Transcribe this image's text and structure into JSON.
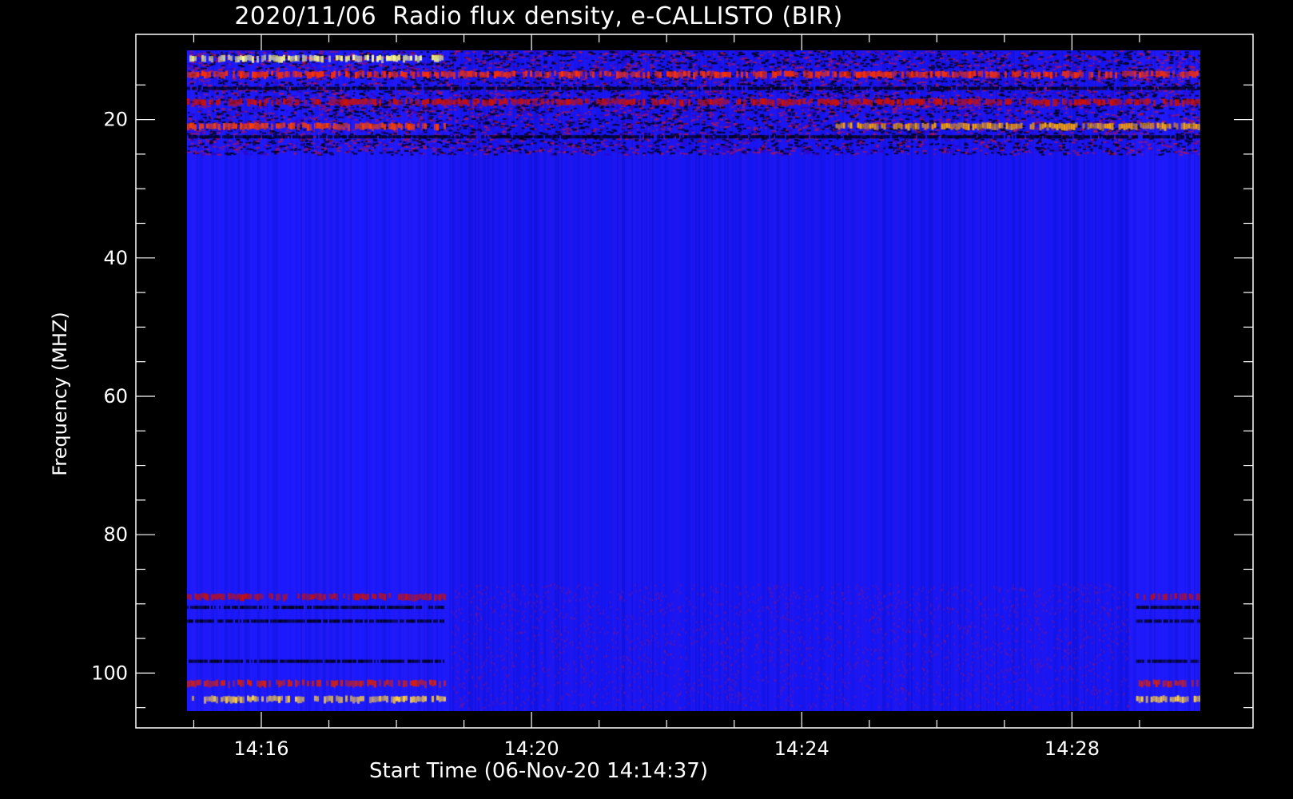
{
  "chart_data": {
    "type": "heatmap",
    "title": "2020/11/06  Radio flux density, e-CALLISTO (BIR)",
    "xlabel": "Start Time (06-Nov-20 14:14:37)",
    "ylabel": "Frequency (MHZ)",
    "x_range_minutes": [
      14.9,
      29.9
    ],
    "y_range_mhz": [
      10,
      105.5
    ],
    "y_inverted": true,
    "x_ticks": [
      {
        "minute": 16,
        "label": "14:16"
      },
      {
        "minute": 20,
        "label": "14:20"
      },
      {
        "minute": 24,
        "label": "14:24"
      },
      {
        "minute": 28,
        "label": "14:28"
      }
    ],
    "y_ticks": [
      {
        "value": 20,
        "label": "20"
      },
      {
        "value": 40,
        "label": "40"
      },
      {
        "value": 60,
        "label": "60"
      },
      {
        "value": 80,
        "label": "80"
      },
      {
        "value": 100,
        "label": "100"
      }
    ],
    "colormap": [
      "#000000",
      "#0000ff",
      "#ff0000",
      "#ffff00",
      "#ffffff"
    ],
    "segments": [
      {
        "start_minute": 14.9,
        "end_minute": 18.8
      },
      {
        "start_minute": 18.8,
        "end_minute": 28.85
      },
      {
        "start_minute": 28.85,
        "end_minute": 29.9
      }
    ],
    "bright_bands": [
      {
        "freq_mhz": 11.2,
        "start_minute": 14.9,
        "end_minute": 18.7,
        "color": "#ffff88"
      },
      {
        "freq_mhz": 13.5,
        "start_minute": 14.9,
        "end_minute": 29.9,
        "color": "#ff3000"
      },
      {
        "freq_mhz": 17.5,
        "start_minute": 14.9,
        "end_minute": 29.9,
        "color": "#d01000"
      },
      {
        "freq_mhz": 21.0,
        "start_minute": 14.9,
        "end_minute": 18.7,
        "color": "#ff4000"
      },
      {
        "freq_mhz": 21.0,
        "start_minute": 24.5,
        "end_minute": 29.9,
        "color": "#ffaa00"
      },
      {
        "freq_mhz": 89.0,
        "start_minute": 14.9,
        "end_minute": 18.7,
        "color": "#c01010"
      },
      {
        "freq_mhz": 89.0,
        "start_minute": 28.95,
        "end_minute": 29.9,
        "color": "#c01010"
      },
      {
        "freq_mhz": 101.5,
        "start_minute": 14.9,
        "end_minute": 18.7,
        "color": "#e02000"
      },
      {
        "freq_mhz": 101.5,
        "start_minute": 28.95,
        "end_minute": 29.9,
        "color": "#e02000"
      },
      {
        "freq_mhz": 103.8,
        "start_minute": 14.9,
        "end_minute": 18.7,
        "color": "#ffd040"
      },
      {
        "freq_mhz": 103.8,
        "start_minute": 28.95,
        "end_minute": 29.9,
        "color": "#ffd040"
      }
    ],
    "dark_bands": [
      {
        "freq_mhz": 15.5,
        "start_minute": 14.9,
        "end_minute": 29.9
      },
      {
        "freq_mhz": 22.5,
        "start_minute": 14.9,
        "end_minute": 29.9
      },
      {
        "freq_mhz": 90.5,
        "start_minute": 14.9,
        "end_minute": 18.7
      },
      {
        "freq_mhz": 90.5,
        "start_minute": 28.95,
        "end_minute": 29.9
      },
      {
        "freq_mhz": 92.5,
        "start_minute": 14.9,
        "end_minute": 18.7
      },
      {
        "freq_mhz": 92.5,
        "start_minute": 28.95,
        "end_minute": 29.9
      },
      {
        "freq_mhz": 98.3,
        "start_minute": 14.9,
        "end_minute": 18.7
      },
      {
        "freq_mhz": 98.3,
        "start_minute": 28.95,
        "end_minute": 29.9
      }
    ]
  }
}
